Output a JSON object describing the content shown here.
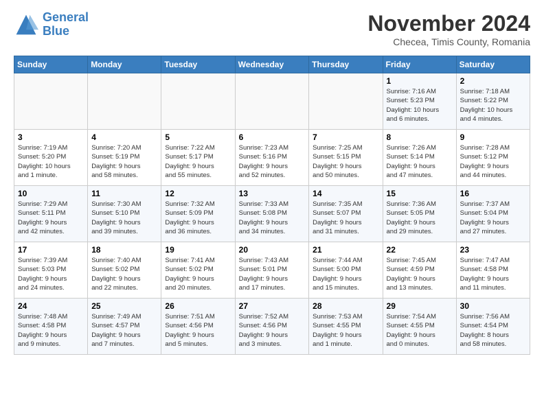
{
  "header": {
    "logo_line1": "General",
    "logo_line2": "Blue",
    "month": "November 2024",
    "location": "Checea, Timis County, Romania"
  },
  "weekdays": [
    "Sunday",
    "Monday",
    "Tuesday",
    "Wednesday",
    "Thursday",
    "Friday",
    "Saturday"
  ],
  "rows": [
    [
      {
        "day": "",
        "info": ""
      },
      {
        "day": "",
        "info": ""
      },
      {
        "day": "",
        "info": ""
      },
      {
        "day": "",
        "info": ""
      },
      {
        "day": "",
        "info": ""
      },
      {
        "day": "1",
        "info": "Sunrise: 7:16 AM\nSunset: 5:23 PM\nDaylight: 10 hours\nand 6 minutes."
      },
      {
        "day": "2",
        "info": "Sunrise: 7:18 AM\nSunset: 5:22 PM\nDaylight: 10 hours\nand 4 minutes."
      }
    ],
    [
      {
        "day": "3",
        "info": "Sunrise: 7:19 AM\nSunset: 5:20 PM\nDaylight: 10 hours\nand 1 minute."
      },
      {
        "day": "4",
        "info": "Sunrise: 7:20 AM\nSunset: 5:19 PM\nDaylight: 9 hours\nand 58 minutes."
      },
      {
        "day": "5",
        "info": "Sunrise: 7:22 AM\nSunset: 5:17 PM\nDaylight: 9 hours\nand 55 minutes."
      },
      {
        "day": "6",
        "info": "Sunrise: 7:23 AM\nSunset: 5:16 PM\nDaylight: 9 hours\nand 52 minutes."
      },
      {
        "day": "7",
        "info": "Sunrise: 7:25 AM\nSunset: 5:15 PM\nDaylight: 9 hours\nand 50 minutes."
      },
      {
        "day": "8",
        "info": "Sunrise: 7:26 AM\nSunset: 5:14 PM\nDaylight: 9 hours\nand 47 minutes."
      },
      {
        "day": "9",
        "info": "Sunrise: 7:28 AM\nSunset: 5:12 PM\nDaylight: 9 hours\nand 44 minutes."
      }
    ],
    [
      {
        "day": "10",
        "info": "Sunrise: 7:29 AM\nSunset: 5:11 PM\nDaylight: 9 hours\nand 42 minutes."
      },
      {
        "day": "11",
        "info": "Sunrise: 7:30 AM\nSunset: 5:10 PM\nDaylight: 9 hours\nand 39 minutes."
      },
      {
        "day": "12",
        "info": "Sunrise: 7:32 AM\nSunset: 5:09 PM\nDaylight: 9 hours\nand 36 minutes."
      },
      {
        "day": "13",
        "info": "Sunrise: 7:33 AM\nSunset: 5:08 PM\nDaylight: 9 hours\nand 34 minutes."
      },
      {
        "day": "14",
        "info": "Sunrise: 7:35 AM\nSunset: 5:07 PM\nDaylight: 9 hours\nand 31 minutes."
      },
      {
        "day": "15",
        "info": "Sunrise: 7:36 AM\nSunset: 5:05 PM\nDaylight: 9 hours\nand 29 minutes."
      },
      {
        "day": "16",
        "info": "Sunrise: 7:37 AM\nSunset: 5:04 PM\nDaylight: 9 hours\nand 27 minutes."
      }
    ],
    [
      {
        "day": "17",
        "info": "Sunrise: 7:39 AM\nSunset: 5:03 PM\nDaylight: 9 hours\nand 24 minutes."
      },
      {
        "day": "18",
        "info": "Sunrise: 7:40 AM\nSunset: 5:02 PM\nDaylight: 9 hours\nand 22 minutes."
      },
      {
        "day": "19",
        "info": "Sunrise: 7:41 AM\nSunset: 5:02 PM\nDaylight: 9 hours\nand 20 minutes."
      },
      {
        "day": "20",
        "info": "Sunrise: 7:43 AM\nSunset: 5:01 PM\nDaylight: 9 hours\nand 17 minutes."
      },
      {
        "day": "21",
        "info": "Sunrise: 7:44 AM\nSunset: 5:00 PM\nDaylight: 9 hours\nand 15 minutes."
      },
      {
        "day": "22",
        "info": "Sunrise: 7:45 AM\nSunset: 4:59 PM\nDaylight: 9 hours\nand 13 minutes."
      },
      {
        "day": "23",
        "info": "Sunrise: 7:47 AM\nSunset: 4:58 PM\nDaylight: 9 hours\nand 11 minutes."
      }
    ],
    [
      {
        "day": "24",
        "info": "Sunrise: 7:48 AM\nSunset: 4:58 PM\nDaylight: 9 hours\nand 9 minutes."
      },
      {
        "day": "25",
        "info": "Sunrise: 7:49 AM\nSunset: 4:57 PM\nDaylight: 9 hours\nand 7 minutes."
      },
      {
        "day": "26",
        "info": "Sunrise: 7:51 AM\nSunset: 4:56 PM\nDaylight: 9 hours\nand 5 minutes."
      },
      {
        "day": "27",
        "info": "Sunrise: 7:52 AM\nSunset: 4:56 PM\nDaylight: 9 hours\nand 3 minutes."
      },
      {
        "day": "28",
        "info": "Sunrise: 7:53 AM\nSunset: 4:55 PM\nDaylight: 9 hours\nand 1 minute."
      },
      {
        "day": "29",
        "info": "Sunrise: 7:54 AM\nSunset: 4:55 PM\nDaylight: 9 hours\nand 0 minutes."
      },
      {
        "day": "30",
        "info": "Sunrise: 7:56 AM\nSunset: 4:54 PM\nDaylight: 8 hours\nand 58 minutes."
      }
    ]
  ]
}
